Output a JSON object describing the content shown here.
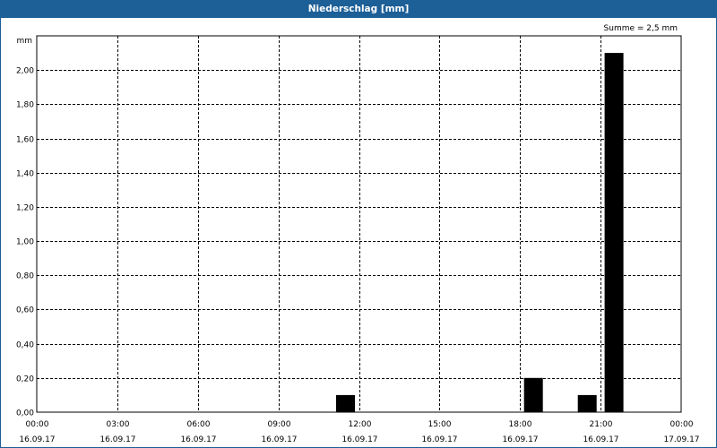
{
  "window": {
    "title": "Niederschlag [mm]"
  },
  "chart_data": {
    "type": "bar",
    "title": "Niederschlag [mm]",
    "ylabel": "mm",
    "xlabel": "",
    "summary": "Summe = 2,5 mm",
    "ylim": [
      0,
      2.2
    ],
    "xlim_hours": [
      0,
      24
    ],
    "grid": true,
    "yticks": [
      {
        "value": 0.0,
        "label": "0,00"
      },
      {
        "value": 0.2,
        "label": "0,20"
      },
      {
        "value": 0.4,
        "label": "0,40"
      },
      {
        "value": 0.6,
        "label": "0,60"
      },
      {
        "value": 0.8,
        "label": "0,80"
      },
      {
        "value": 1.0,
        "label": "1,00"
      },
      {
        "value": 1.2,
        "label": "1,20"
      },
      {
        "value": 1.4,
        "label": "1,40"
      },
      {
        "value": 1.6,
        "label": "1,60"
      },
      {
        "value": 1.8,
        "label": "1,80"
      },
      {
        "value": 2.0,
        "label": "2,00"
      }
    ],
    "xticks": [
      {
        "hour": 0,
        "time": "00:00",
        "date": "16.09.17"
      },
      {
        "hour": 3,
        "time": "03:00",
        "date": "16.09.17"
      },
      {
        "hour": 6,
        "time": "06:00",
        "date": "16.09.17"
      },
      {
        "hour": 9,
        "time": "09:00",
        "date": "16.09.17"
      },
      {
        "hour": 12,
        "time": "12:00",
        "date": "16.09.17"
      },
      {
        "hour": 15,
        "time": "15:00",
        "date": "16.09.17"
      },
      {
        "hour": 18,
        "time": "18:00",
        "date": "16.09.17"
      },
      {
        "hour": 21,
        "time": "21:00",
        "date": "16.09.17"
      },
      {
        "hour": 24,
        "time": "00:00",
        "date": "17.09.17"
      }
    ],
    "bars": [
      {
        "hour": 11.5,
        "value": 0.1
      },
      {
        "hour": 18.5,
        "value": 0.2
      },
      {
        "hour": 20.5,
        "value": 0.1
      },
      {
        "hour": 21.5,
        "value": 2.1
      }
    ],
    "bar_color": "#000000"
  }
}
